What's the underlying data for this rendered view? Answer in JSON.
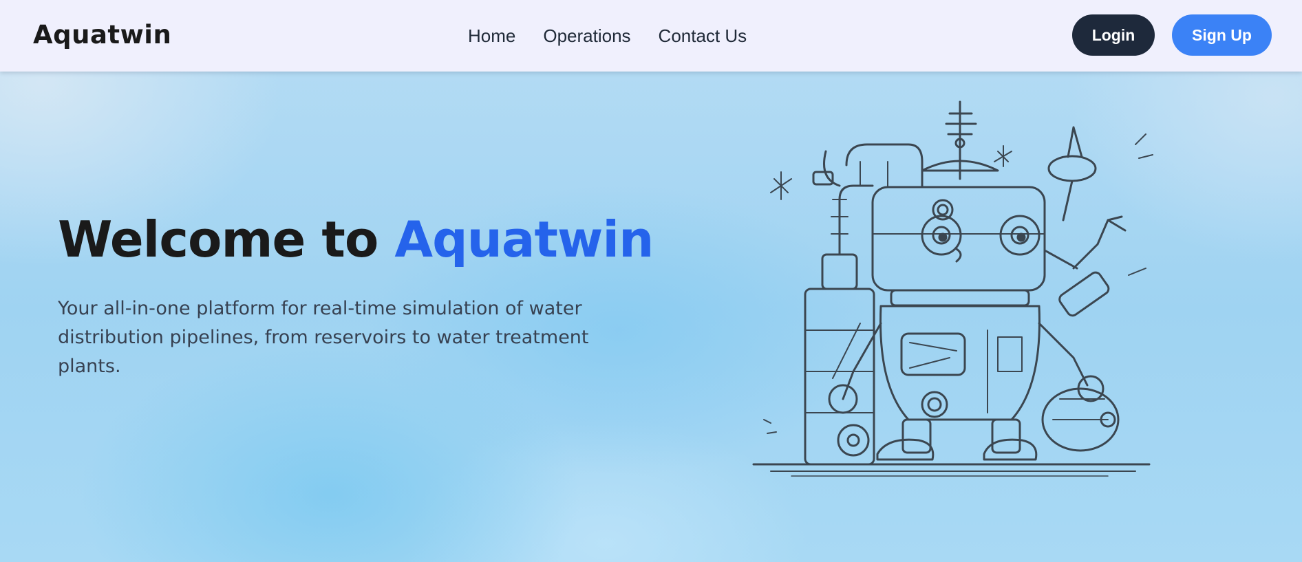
{
  "navbar": {
    "logo": "Aquatwin",
    "links": [
      {
        "label": "Home"
      },
      {
        "label": "Operations"
      },
      {
        "label": "Contact Us"
      }
    ],
    "login_label": "Login",
    "signup_label": "Sign Up"
  },
  "hero": {
    "title_prefix": "Welcome to ",
    "title_brand": "Aquatwin",
    "description": "Your all-in-one platform for real-time simulation of water distribution pipelines, from reservoirs to water treatment plants.",
    "illustration": "robot-pipeline-illustration"
  },
  "colors": {
    "brand": "#2563eb",
    "login_bg": "#1e293b",
    "signup_bg": "#3b82f6",
    "navbar_bg": "#f0f0fd"
  }
}
